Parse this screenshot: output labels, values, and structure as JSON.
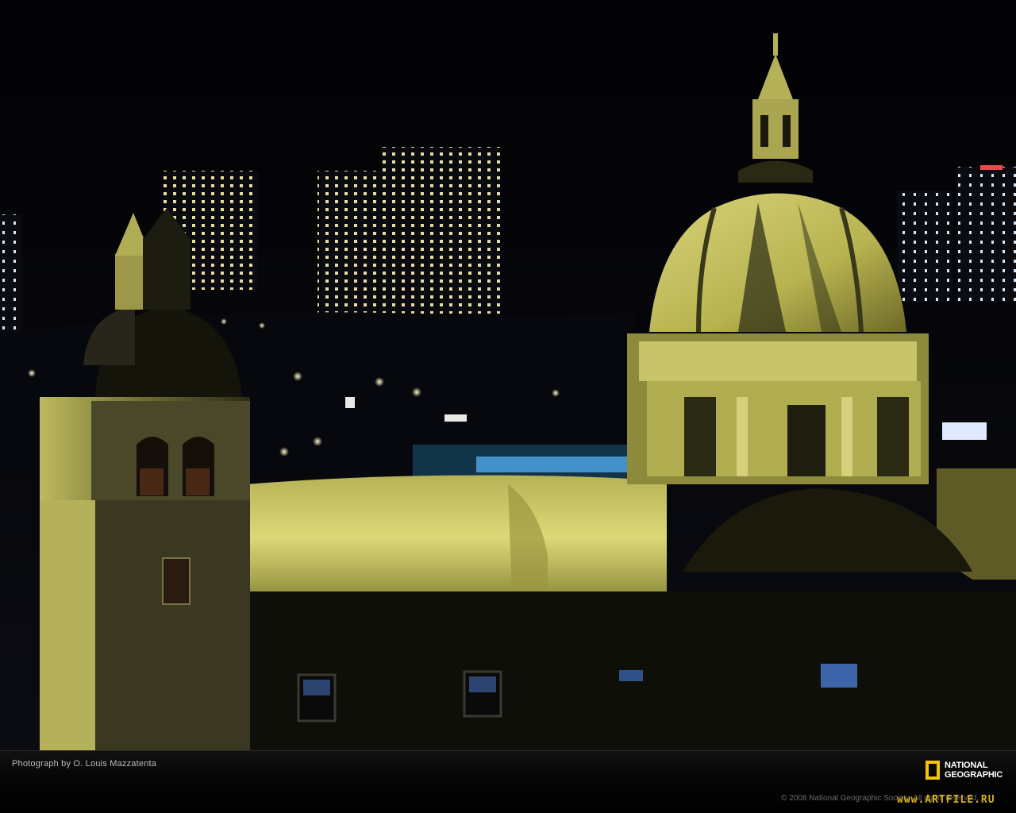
{
  "scene": {
    "description_free": true,
    "photo_credit": "Photograph by O. Louis Mazzatenta",
    "copyright": "© 2008 National Geographic Society. All rights reserved.",
    "watermark": "www.ARTFILE.RU",
    "logo": {
      "line1": "NATIONAL",
      "line2": "GEOGRAPHIC",
      "frame_color": "#f5c400"
    },
    "colors": {
      "sky": "#05060a",
      "stone_lit": "#c9c45a",
      "stone_dark": "#1a1a10",
      "city_light": "#ffe9a8",
      "blue_light": "#5ab8ff"
    }
  }
}
